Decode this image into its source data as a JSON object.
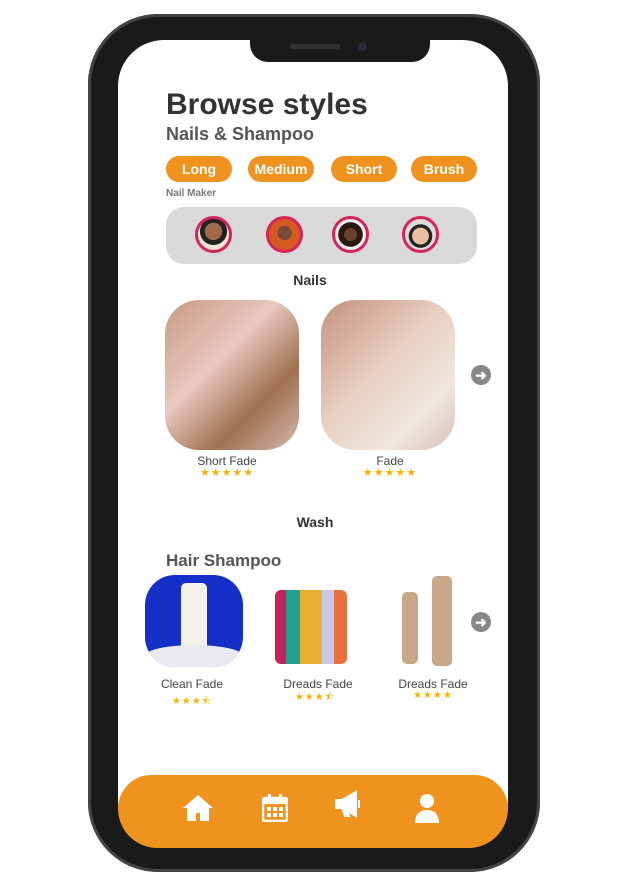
{
  "header": {
    "title": "Browse styles",
    "subtitle": "Nails & Shampoo"
  },
  "filters": [
    "Long",
    "Medium",
    "Short",
    "Brush"
  ],
  "nail_maker": {
    "label": "Nail Maker",
    "avatars": 4
  },
  "nails": {
    "title": "Nails",
    "items": [
      {
        "name": "Short Fade",
        "rating": 5,
        "stars": "★★★★★"
      },
      {
        "name": "Fade",
        "rating": 5,
        "stars": "★★★★★"
      }
    ]
  },
  "wash": {
    "title": "Wash",
    "subtitle": "Hair Shampoo",
    "items": [
      {
        "name": "Clean Fade",
        "rating": 3.5,
        "stars": "★★★⯪"
      },
      {
        "name": "Dreads Fade",
        "rating": 3.5,
        "stars": "★★★⯪"
      },
      {
        "name": "Dreads Fade",
        "rating": 4,
        "stars": "★★★★"
      }
    ]
  },
  "nav": [
    "home",
    "calendar",
    "announcements",
    "profile"
  ],
  "colors": {
    "accent": "#f0931e",
    "star": "#f4b400"
  }
}
